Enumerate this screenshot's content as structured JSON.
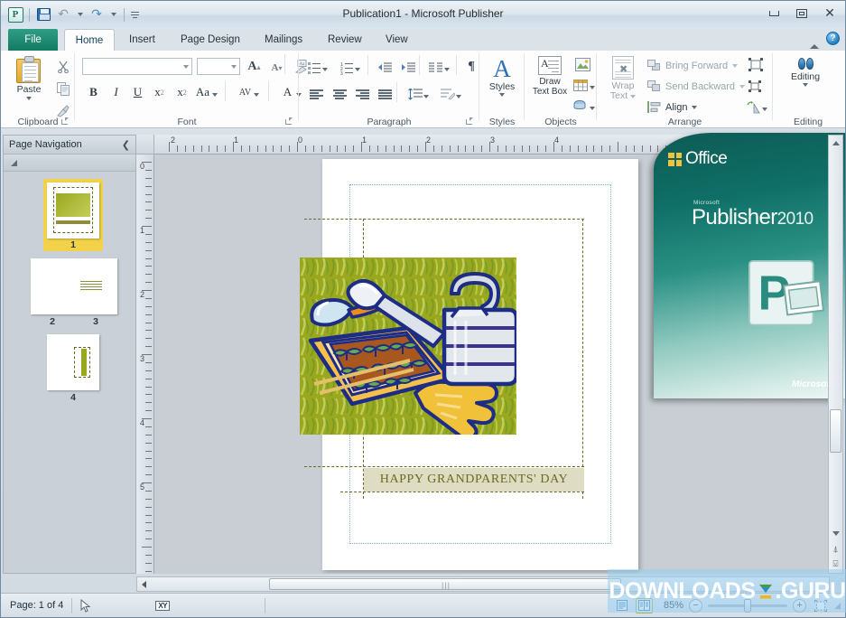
{
  "window": {
    "title": "Publication1  -  Microsoft Publisher",
    "minimize_label": "Minimize",
    "restore_label": "Restore Down",
    "close_label": "Close",
    "collapse_ribbon_label": "Minimize the Ribbon",
    "help_label": "?"
  },
  "quick_access": {
    "app_logo": "publisher-logo",
    "items": [
      {
        "name": "save-icon",
        "label": "Save"
      },
      {
        "name": "undo-icon",
        "label": "Undo"
      },
      {
        "name": "redo-icon",
        "label": "Redo"
      },
      {
        "name": "customize-qat-icon",
        "label": "Customize Quick Access Toolbar"
      }
    ]
  },
  "tabs": [
    {
      "id": "file",
      "label": "File",
      "active": false
    },
    {
      "id": "home",
      "label": "Home",
      "active": true
    },
    {
      "id": "insert",
      "label": "Insert",
      "active": false
    },
    {
      "id": "page-design",
      "label": "Page Design",
      "active": false
    },
    {
      "id": "mailings",
      "label": "Mailings",
      "active": false
    },
    {
      "id": "review",
      "label": "Review",
      "active": false
    },
    {
      "id": "view",
      "label": "View",
      "active": false
    }
  ],
  "ribbon": {
    "groups": [
      {
        "id": "clipboard",
        "label": "Clipboard"
      },
      {
        "id": "font",
        "label": "Font"
      },
      {
        "id": "paragraph",
        "label": "Paragraph"
      },
      {
        "id": "styles",
        "label": "Styles"
      },
      {
        "id": "objects",
        "label": "Objects"
      },
      {
        "id": "arrange",
        "label": "Arrange"
      },
      {
        "id": "editing",
        "label": "Editing"
      }
    ],
    "clipboard": {
      "paste_label": "Paste",
      "cut_label": "Cut",
      "copy_label": "Copy",
      "format_painter_label": "Format Painter"
    },
    "font": {
      "font_name_value": "",
      "font_name_placeholder": "",
      "font_size_value": "",
      "font_size_placeholder": "",
      "grow_font_label": "A",
      "shrink_font_label": "A",
      "clear_formatting_label": "Aa",
      "bold_label": "B",
      "italic_label": "I",
      "underline_label": "U",
      "subscript_label": "x",
      "superscript_label": "x",
      "change_case_label": "Aa",
      "character_spacing_label": "AV",
      "font_color_label": "A"
    },
    "paragraph": {
      "bullets_label": "Bullets",
      "numbering_label": "Numbering",
      "decrease_indent_label": "Decrease Indent",
      "increase_indent_label": "Increase Indent",
      "columns_label": "Columns",
      "show_marks_label": "¶",
      "align_left_label": "Align Left",
      "align_center_label": "Center",
      "align_right_label": "Align Right",
      "justify_label": "Justify",
      "line_spacing_label": "Line Spacing",
      "baseline_label": "Baseline Guides"
    },
    "styles": {
      "styles_label": "Styles"
    },
    "objects": {
      "draw_text_box_label": "Draw\nText Box",
      "draw_text_box_line1": "Draw",
      "draw_text_box_line2": "Text Box",
      "picture_label": "Picture",
      "table_label": "Table",
      "shapes_label": "Shapes"
    },
    "arrange": {
      "wrap_text_line1": "Wrap",
      "wrap_text_line2": "Text",
      "bring_forward_label": "Bring Forward",
      "send_backward_label": "Send Backward",
      "align_label": "Align",
      "group_label": "Group",
      "ungroup_label": "Ungroup",
      "rotate_label": "Rotate"
    },
    "editing": {
      "editing_label": "Editing"
    }
  },
  "page_navigation": {
    "title": "Page Navigation",
    "collapse_icon": "chevron-left-icon",
    "expand_icon": "expand-triangle-icon",
    "pages": [
      {
        "number": "1",
        "selected": true
      },
      {
        "number": "2",
        "selected": false
      },
      {
        "number": "3",
        "selected": false
      },
      {
        "number": "4",
        "selected": false
      }
    ]
  },
  "rulers": {
    "horizontal_ticks": [
      "2",
      "1",
      "0",
      "1",
      "2",
      "3",
      "4"
    ],
    "vertical_ticks": [
      "0",
      "1",
      "2",
      "3",
      "4",
      "5"
    ],
    "unit": "inches"
  },
  "document": {
    "card_title": "HAPPY GRANDPARENTS' DAY",
    "clipart_name": "gardening-watering-can-seedling-tray-clipart",
    "clipart_alt": "Watering can, trowel and seedling tray illustration"
  },
  "splash": {
    "office_label": "Office",
    "microsoft_small": "Microsoft",
    "product_name": "Publisher",
    "product_year": "2010",
    "brand": "Microsoft",
    "logo_letter": "P"
  },
  "status_bar": {
    "page_label": "Page: 1 of 4",
    "cursor_icon": "mouse-pointer-icon",
    "object_position_icon": "xy-position-icon",
    "single_page_label": "Single Page View",
    "two_page_label": "Two-Page Spread View",
    "zoom_level": "85%",
    "zoom_out_label": "−",
    "zoom_in_label": "+",
    "fit_page_label": "Fit Page to Current Window"
  },
  "watermark": {
    "text_left": "DOWNLOADS",
    "text_right": ".GURU"
  },
  "colors": {
    "accent_green": "#14786a",
    "file_tab": "#127a62",
    "selection_yellow": "#f3d24a",
    "title_text_olive": "#6b6b21",
    "band_bg": "#dedcc2",
    "guide_blue": "#7ea7d8",
    "guide_olive": "#6b6a26"
  }
}
